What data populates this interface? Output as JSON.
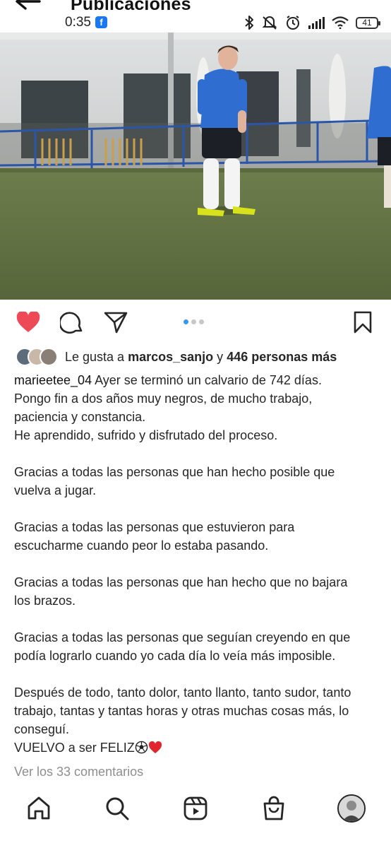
{
  "header": {
    "title": "Publicaciones"
  },
  "status_bar": {
    "time": "0:35",
    "battery": "41"
  },
  "post": {
    "carousel": {
      "count": 3,
      "active_index": 0
    },
    "liked": true,
    "likes": {
      "prefix": "Le gusta a",
      "first_user": "marcos_sanjo",
      "joiner": "y",
      "others": "446 personas más"
    },
    "author": "marieetee_04",
    "caption_lines": [
      "Ayer se terminó un calvario de 742 días.",
      "Pongo fin a dos años muy negros, de mucho trabajo,",
      "paciencia y constancia.",
      "He aprendido, sufrido y disfrutado del proceso.",
      "",
      "Gracias a todas las personas que han hecho posible que",
      "vuelva a jugar.",
      "",
      "Gracias a todas las personas que estuvieron para",
      "escucharme cuando peor lo estaba pasando.",
      "",
      "Gracias a todas las personas que han hecho que no bajara",
      "los brazos.",
      "",
      "Gracias a todas las personas que seguían creyendo en que",
      "podía lograrlo cuando yo cada día lo veía más imposible.",
      "",
      "Después de todo, tanto dolor, tanto llanto, tanto sudor, tanto",
      "trabajo, tantas y tantas horas y otras muchas cosas más, lo",
      "conseguí.",
      "VUELVO a ser FELIZ"
    ],
    "view_comments": "Ver los 33 comentarios"
  },
  "icons": {
    "back": "back-arrow-icon",
    "like": "heart-icon",
    "comment": "comment-icon",
    "share": "send-icon",
    "save": "bookmark-icon",
    "home": "home-icon",
    "search": "search-icon",
    "reels": "reels-icon",
    "shop": "shop-icon",
    "profile": "profile-avatar"
  },
  "colors": {
    "like_red": "#ed4956",
    "carousel_active": "#3897f0",
    "muted_text": "#8e8e8e",
    "facebook_blue": "#1877f2"
  }
}
